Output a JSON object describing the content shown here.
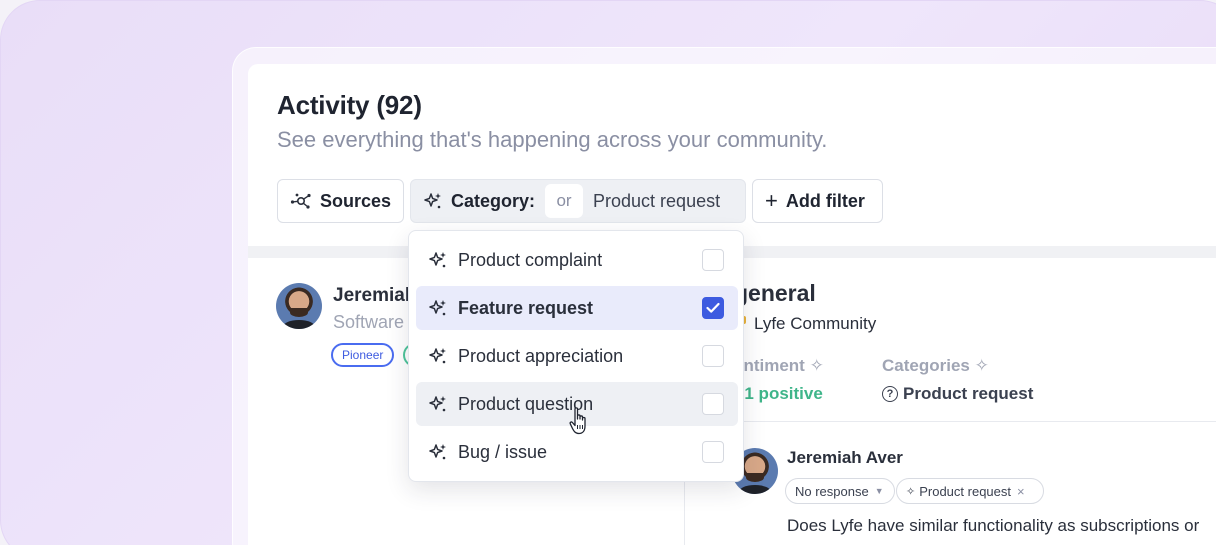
{
  "header": {
    "title": "Activity (92)",
    "subtitle": "See everything that's happening across your community."
  },
  "filters": {
    "sources_label": "Sources",
    "category_label": "Category:",
    "category_operator": "or",
    "category_value": "Product request",
    "add_filter_label": "Add filter"
  },
  "category_dropdown": {
    "options": [
      {
        "label": "Product complaint",
        "checked": false
      },
      {
        "label": "Feature request",
        "checked": true
      },
      {
        "label": "Product appreciation",
        "checked": false
      },
      {
        "label": "Product question",
        "checked": false
      },
      {
        "label": "Bug / issue",
        "checked": false
      }
    ]
  },
  "member": {
    "name": "Jeremiah",
    "role": "Software",
    "badge": "Pioneer"
  },
  "activity": {
    "channel": "#general",
    "channel_visible": "general",
    "community": "Lyfe Community",
    "sentiment_label": "entiment",
    "sentiment_value": ") 1 positive",
    "categories_label": "Categories",
    "categories_value": "Product request"
  },
  "message": {
    "author": "Jeremiah Aver",
    "response_status": "No response",
    "category_tag": "Product request",
    "text": "Does Lyfe have similar functionality as subscriptions or"
  },
  "colors": {
    "accent": "#3d5be0",
    "positive": "#3fb58a",
    "background": "#e9def8"
  }
}
